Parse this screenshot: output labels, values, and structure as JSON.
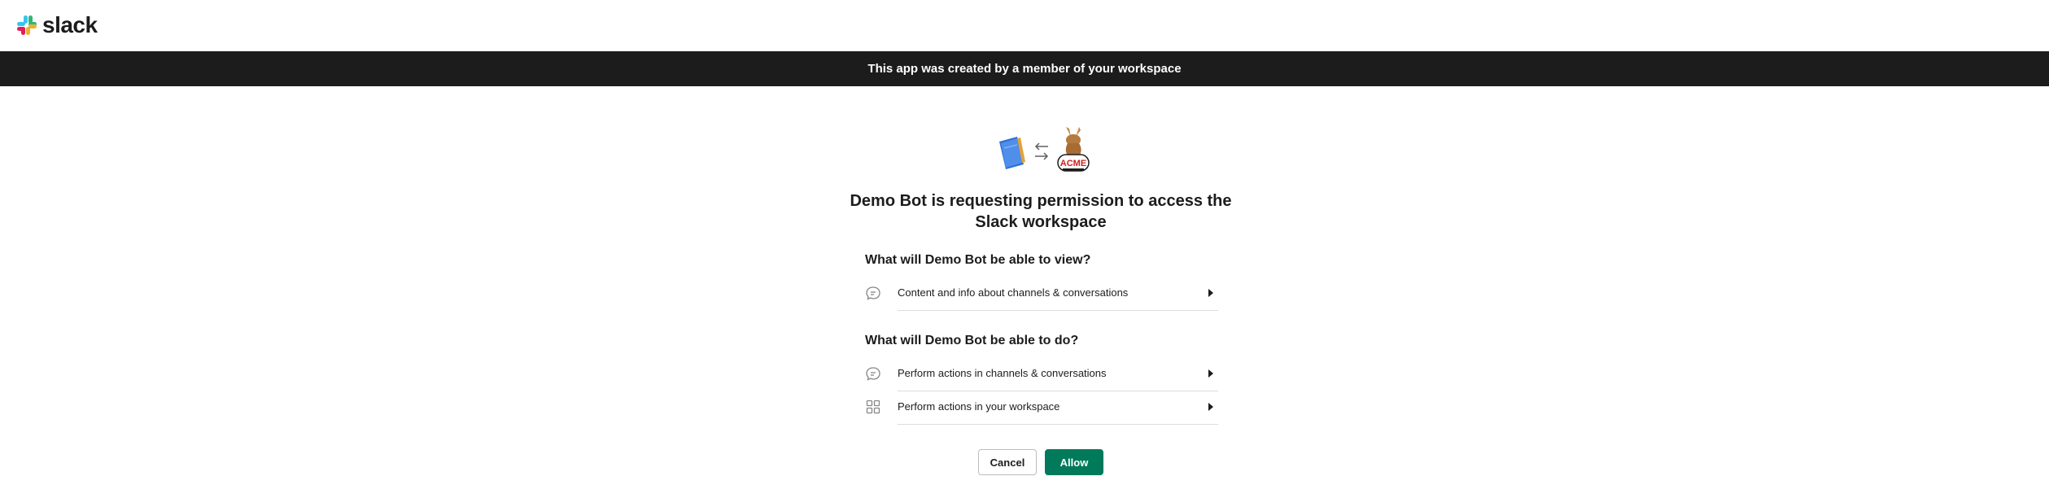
{
  "header": {
    "logo_text": "slack"
  },
  "banner": {
    "text": "This app was created by a member of your workspace"
  },
  "consent": {
    "title": "Demo Bot is requesting permission to access the Slack workspace",
    "view_heading": "What will Demo Bot be able to view?",
    "view_items": [
      {
        "label": "Content and info about channels & conversations",
        "icon": "chat-bubble-icon"
      }
    ],
    "do_heading": "What will Demo Bot be able to do?",
    "do_items": [
      {
        "label": "Perform actions in channels & conversations",
        "icon": "chat-bubble-icon"
      },
      {
        "label": "Perform actions in your workspace",
        "icon": "grid-icon"
      }
    ]
  },
  "actions": {
    "cancel_label": "Cancel",
    "allow_label": "Allow"
  },
  "colors": {
    "banner_bg": "#1d1c1d",
    "allow_bg": "#007a5a",
    "text": "#1d1c1d"
  }
}
